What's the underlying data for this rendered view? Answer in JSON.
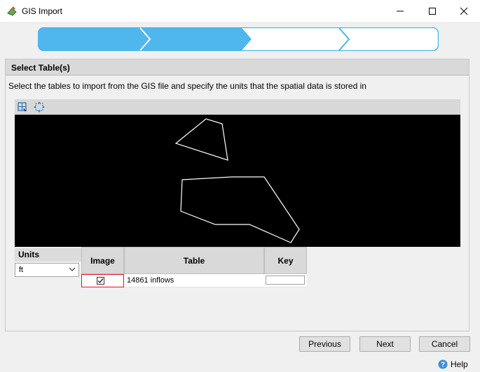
{
  "window": {
    "title": "GIS Import"
  },
  "panel": {
    "title": "Select Table(s)",
    "instructions": "Select the tables to import from the GIS file and specify the units that the spatial data is stored in"
  },
  "units": {
    "label": "Units",
    "selected": "ft"
  },
  "grid": {
    "columns": [
      "Image",
      "Table",
      "Key"
    ],
    "rows": [
      {
        "image_checked": true,
        "table": "14861 inflows",
        "key": ""
      }
    ]
  },
  "buttons": {
    "previous": "Previous",
    "next": "Next",
    "cancel": "Cancel"
  },
  "help": {
    "label": "Help"
  },
  "wizard": {
    "steps_total": 4,
    "steps_completed": 2
  },
  "colors": {
    "wizard_active": "#4fb6ee",
    "wizard_border": "#4fb6ee",
    "map_background": "#000000",
    "map_outline": "#ffffff",
    "selected_cell_border": "#e81123"
  },
  "icons": {
    "app": "gis-globe-icon",
    "zoom_window": "zoom-window-icon",
    "zoom_extents": "zoom-extents-icon",
    "help": "help-icon"
  }
}
